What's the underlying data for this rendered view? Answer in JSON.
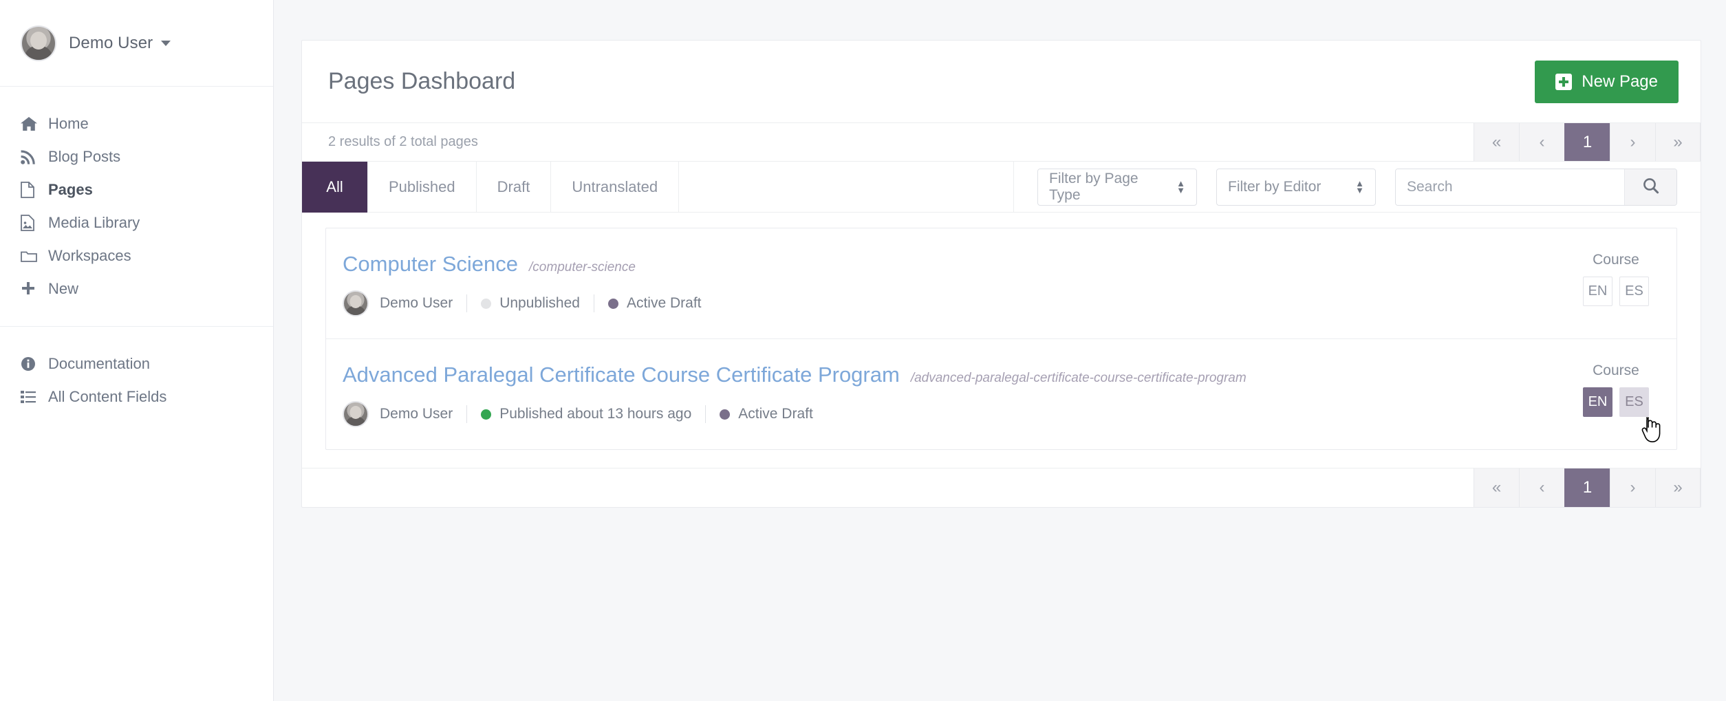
{
  "sidebar": {
    "user": {
      "name": "Demo User",
      "avatar_icon": "user-avatar"
    },
    "groups": [
      {
        "items": [
          {
            "label": "Home",
            "icon": "home-icon",
            "active": false
          },
          {
            "label": "Blog Posts",
            "icon": "rss-icon",
            "active": false
          },
          {
            "label": "Pages",
            "icon": "file-icon",
            "active": true
          },
          {
            "label": "Media Library",
            "icon": "image-file-icon",
            "active": false
          },
          {
            "label": "Workspaces",
            "icon": "folder-icon",
            "active": false
          },
          {
            "label": "New",
            "icon": "plus-icon",
            "active": false
          }
        ]
      },
      {
        "items": [
          {
            "label": "Documentation",
            "icon": "info-icon",
            "active": false
          },
          {
            "label": "All Content Fields",
            "icon": "list-icon",
            "active": false
          }
        ]
      }
    ]
  },
  "header": {
    "title": "Pages Dashboard",
    "new_page_label": "New Page",
    "new_page_icon": "plus-square-icon"
  },
  "results": {
    "summary": "2 results of 2 total pages"
  },
  "pagination": {
    "first": "«",
    "prev": "‹",
    "current": "1",
    "next": "›",
    "last": "»"
  },
  "filters": {
    "tabs": [
      {
        "label": "All",
        "active": true
      },
      {
        "label": "Published",
        "active": false
      },
      {
        "label": "Draft",
        "active": false
      },
      {
        "label": "Untranslated",
        "active": false
      }
    ],
    "page_type_select": {
      "value": "Filter by Page Type"
    },
    "editor_select": {
      "value": "Filter by Editor"
    },
    "search": {
      "value": "",
      "placeholder": "Search",
      "icon": "search-icon"
    }
  },
  "pages": [
    {
      "title": "Computer Science",
      "slug": "/computer-science",
      "author": "Demo User",
      "status": {
        "text": "Unpublished",
        "color": "#e3e4e6"
      },
      "draft": {
        "text": "Active Draft",
        "color": "#7a6f8a"
      },
      "type_label": "Course",
      "languages": [
        {
          "code": "EN",
          "state": "inactive"
        },
        {
          "code": "ES",
          "state": "inactive"
        }
      ]
    },
    {
      "title": "Advanced Paralegal Certificate Course Certificate Program",
      "slug": "/advanced-paralegal-certificate-course-certificate-program",
      "author": "Demo User",
      "status": {
        "text": "Published about 13 hours ago",
        "color": "#33a651"
      },
      "draft": {
        "text": "Active Draft",
        "color": "#7a6f8a"
      },
      "type_label": "Course",
      "languages": [
        {
          "code": "EN",
          "state": "active"
        },
        {
          "code": "ES",
          "state": "hover"
        }
      ]
    }
  ],
  "colors": {
    "accent_purple": "#473157",
    "pager_purple": "#7a6f8a",
    "green": "#329a4e",
    "link_blue": "#7da7d9",
    "page_bg": "#f6f7f9"
  }
}
